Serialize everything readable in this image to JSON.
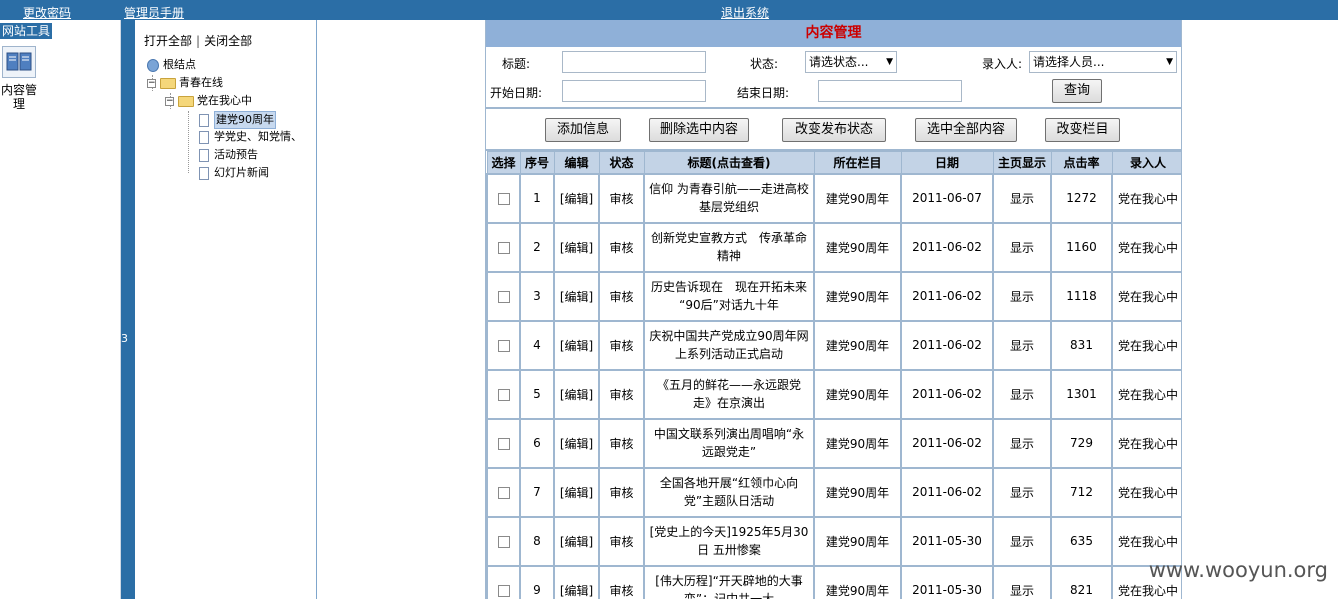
{
  "topbar": {
    "change_password": "更改密码",
    "admin_manual": "管理员手册",
    "logout": "退出系统"
  },
  "tools": {
    "title": "网站工具",
    "item_label": "内容管理"
  },
  "splitter": {
    "mark": "3"
  },
  "tree": {
    "open_all": "打开全部",
    "separator": "|",
    "close_all": "关闭全部",
    "root": "根结点",
    "level1": "青春在线",
    "level2": "党在我心中",
    "leaves": [
      "建党90周年",
      "学党史、知党情、",
      "活动预告",
      "幻灯片新闻"
    ]
  },
  "main": {
    "title": "内容管理",
    "search": {
      "title_label": "标题:",
      "status_label": "状态:",
      "status_value": "请选状态...",
      "entry_label": "录入人:",
      "entry_value": "请选择人员...",
      "start_label": "开始日期:",
      "end_label": "结束日期:",
      "query_button": "查询"
    },
    "actions": {
      "add": "添加信息",
      "delete": "删除选中内容",
      "change_status": "改变发布状态",
      "select_all": "选中全部内容",
      "change_column": "改变栏目"
    },
    "columns": [
      "选择",
      "序号",
      "编辑",
      "状态",
      "标题(点击查看)",
      "所在栏目",
      "日期",
      "主页显示",
      "点击率",
      "录入人"
    ],
    "rows": [
      {
        "no": "1",
        "edit": "[编辑]",
        "status": "审核",
        "title": "信仰 为青春引航——走进高校基层党组织",
        "column": "建党90周年",
        "date": "2011-06-07",
        "home": "显示",
        "clicks": "1272",
        "author": "党在我心中"
      },
      {
        "no": "2",
        "edit": "[编辑]",
        "status": "审核",
        "title": "创新党史宣教方式　传承革命精神",
        "column": "建党90周年",
        "date": "2011-06-02",
        "home": "显示",
        "clicks": "1160",
        "author": "党在我心中"
      },
      {
        "no": "3",
        "edit": "[编辑]",
        "status": "审核",
        "title": "历史告诉现在　现在开拓未来 “90后”对话九十年",
        "column": "建党90周年",
        "date": "2011-06-02",
        "home": "显示",
        "clicks": "1118",
        "author": "党在我心中"
      },
      {
        "no": "4",
        "edit": "[编辑]",
        "status": "审核",
        "title": "庆祝中国共产党成立90周年网上系列活动正式启动",
        "column": "建党90周年",
        "date": "2011-06-02",
        "home": "显示",
        "clicks": "831",
        "author": "党在我心中"
      },
      {
        "no": "5",
        "edit": "[编辑]",
        "status": "审核",
        "title": "《五月的鲜花——永远跟党走》在京演出",
        "column": "建党90周年",
        "date": "2011-06-02",
        "home": "显示",
        "clicks": "1301",
        "author": "党在我心中"
      },
      {
        "no": "6",
        "edit": "[编辑]",
        "status": "审核",
        "title": "中国文联系列演出周唱响“永远跟党走”",
        "column": "建党90周年",
        "date": "2011-06-02",
        "home": "显示",
        "clicks": "729",
        "author": "党在我心中"
      },
      {
        "no": "7",
        "edit": "[编辑]",
        "status": "审核",
        "title": "全国各地开展“红领巾心向党”主题队日活动",
        "column": "建党90周年",
        "date": "2011-06-02",
        "home": "显示",
        "clicks": "712",
        "author": "党在我心中"
      },
      {
        "no": "8",
        "edit": "[编辑]",
        "status": "审核",
        "title": "[党史上的今天]1925年5月30日 五卅惨案",
        "column": "建党90周年",
        "date": "2011-05-30",
        "home": "显示",
        "clicks": "635",
        "author": "党在我心中"
      },
      {
        "no": "9",
        "edit": "[编辑]",
        "status": "审核",
        "title": "[伟大历程]“开天辟地的大事变”：记中共一大",
        "column": "建党90周年",
        "date": "2011-05-30",
        "home": "显示",
        "clicks": "821",
        "author": "党在我心中"
      }
    ]
  },
  "watermark": "www.wooyun.org"
}
